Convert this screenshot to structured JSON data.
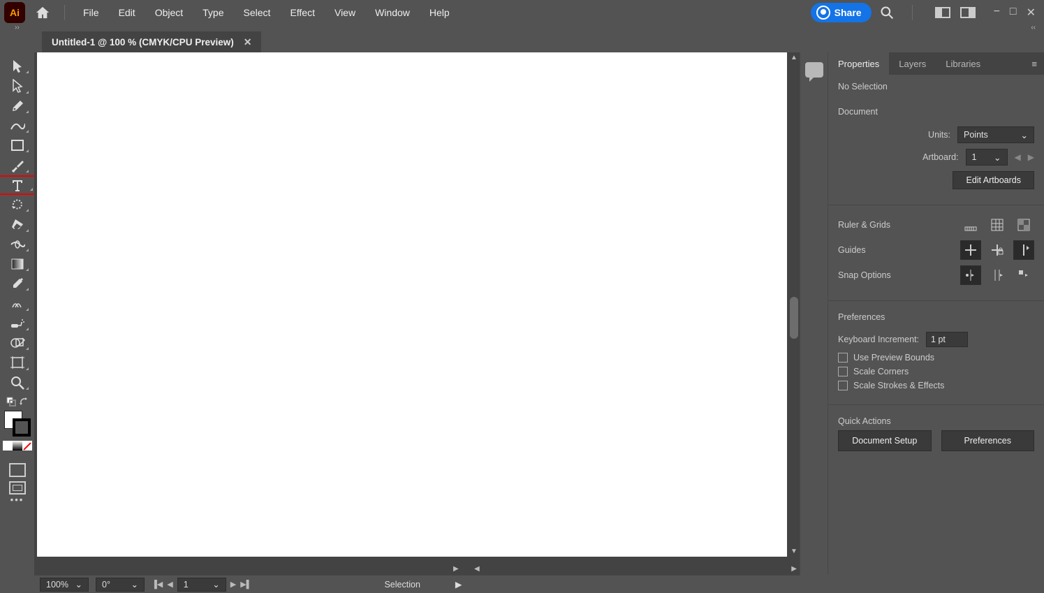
{
  "app": {
    "badge": "Ai"
  },
  "menu": {
    "items": [
      "File",
      "Edit",
      "Object",
      "Type",
      "Select",
      "Effect",
      "View",
      "Window",
      "Help"
    ],
    "share": "Share"
  },
  "document": {
    "tab_title": "Untitled-1 @ 100 % (CMYK/CPU Preview)"
  },
  "status": {
    "zoom": "100%",
    "rotate": "0°",
    "artboard_nav": "1",
    "tool_label": "Selection"
  },
  "panel": {
    "tabs": {
      "properties": "Properties",
      "layers": "Layers",
      "libraries": "Libraries"
    },
    "selection_state": "No Selection",
    "document_section": {
      "title": "Document",
      "units_label": "Units:",
      "units_value": "Points",
      "artboard_label": "Artboard:",
      "artboard_value": "1",
      "edit_artboards": "Edit Artboards"
    },
    "ruler_grids": {
      "title": "Ruler & Grids"
    },
    "guides": {
      "title": "Guides"
    },
    "snap": {
      "title": "Snap Options"
    },
    "preferences_section": {
      "title": "Preferences",
      "keyboard_incr_label": "Keyboard Increment:",
      "keyboard_incr_value": "1 pt",
      "use_preview_bounds": "Use Preview Bounds",
      "scale_corners": "Scale Corners",
      "scale_strokes": "Scale Strokes & Effects"
    },
    "quick_actions": {
      "title": "Quick Actions",
      "document_setup": "Document Setup",
      "preferences_btn": "Preferences"
    }
  },
  "tool_icons": [
    "selection",
    "direct-selection",
    "pen",
    "curvature",
    "rectangle",
    "paintbrush",
    "type",
    "rotate",
    "eraser",
    "width",
    "gradient",
    "eyedropper",
    "blend",
    "symbol-sprayer",
    "shape-builder",
    "artboard",
    "zoom"
  ]
}
